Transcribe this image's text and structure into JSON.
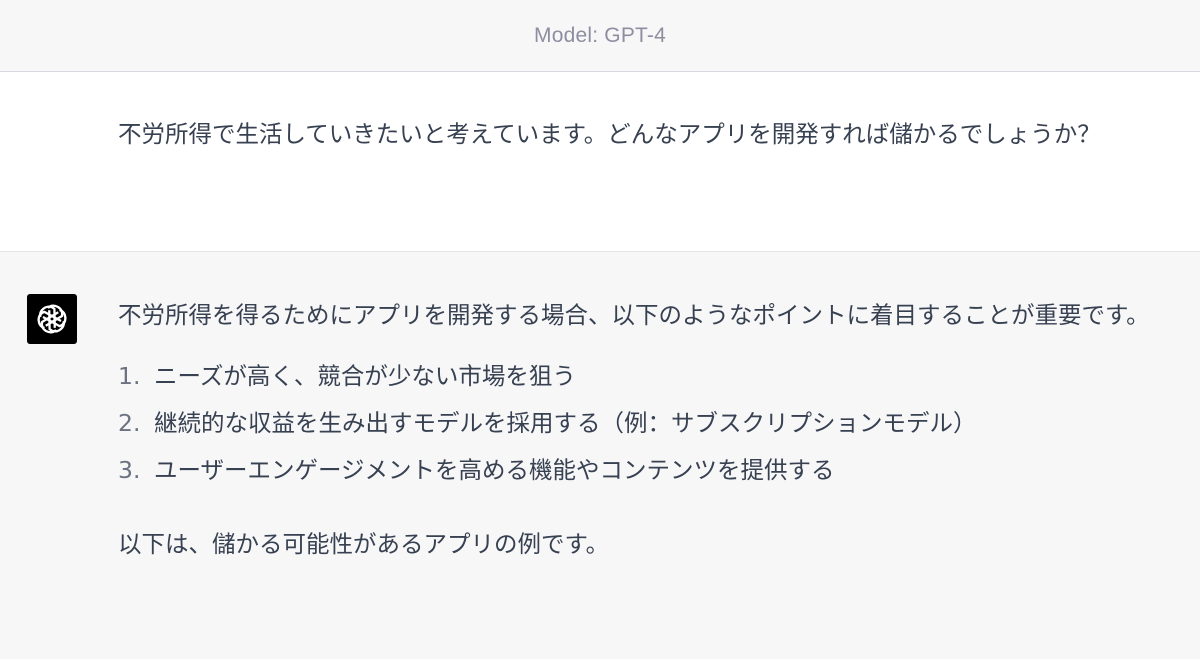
{
  "header": {
    "model_label": "Model: GPT-4"
  },
  "user_message": {
    "text": "不労所得で生活していきたいと考えています。どんなアプリを開発すれば儲かるでしょうか？"
  },
  "assistant_message": {
    "avatar_icon": "openai-logo-icon",
    "intro": "不労所得を得るためにアプリを開発する場合、以下のようなポイントに着目することが重要です。",
    "points": [
      {
        "num": "1.",
        "text": "ニーズが高く、競合が少ない市場を狙う"
      },
      {
        "num": "2.",
        "text": "継続的な収益を生み出すモデルを採用する（例：サブスクリプションモデル）"
      },
      {
        "num": "3.",
        "text": "ユーザーエンゲージメントを高める機能やコンテンツを提供する"
      }
    ],
    "outro": "以下は、儲かる可能性があるアプリの例です。"
  },
  "colors": {
    "header_bg": "#f7f7f8",
    "assistant_bg": "#f7f7f8",
    "text": "#374151",
    "muted": "#8e8ea0",
    "avatar_bg": "#000000"
  }
}
